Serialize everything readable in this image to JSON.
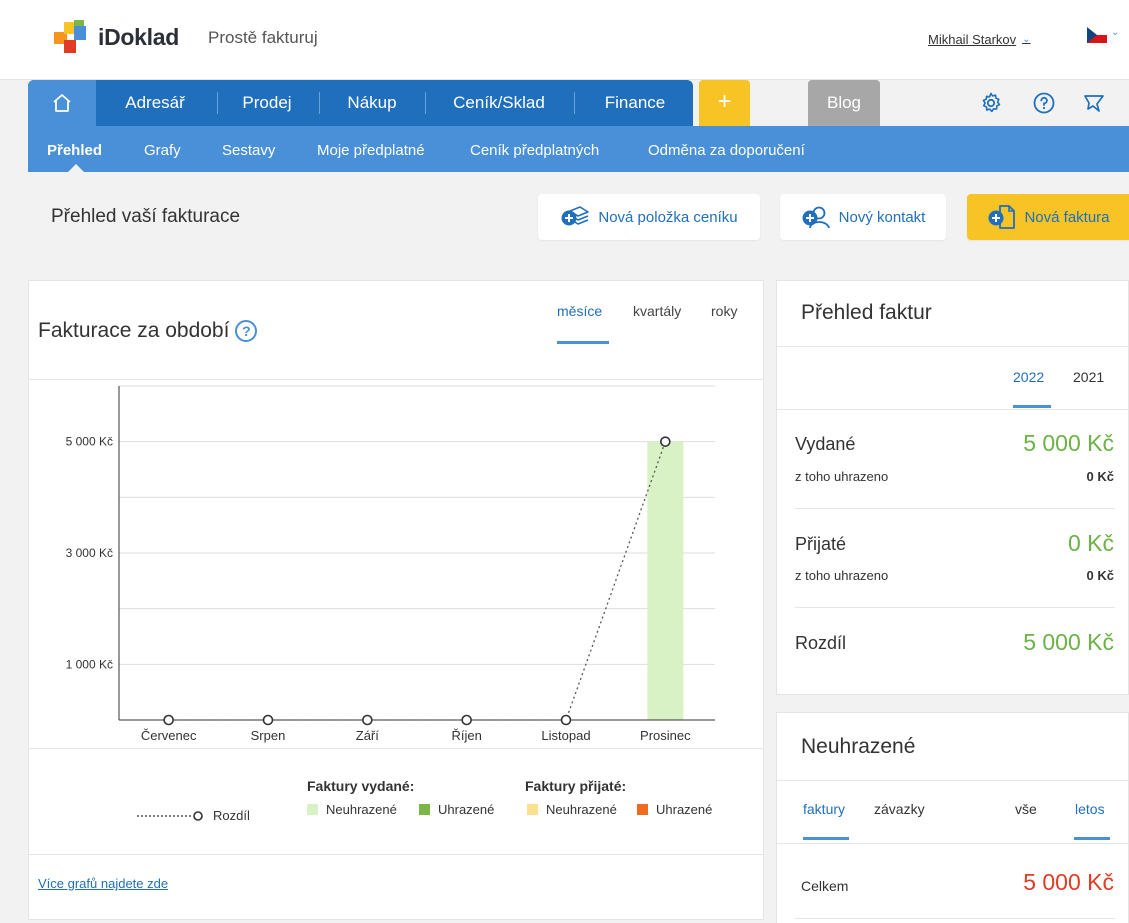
{
  "header": {
    "logo_text": "iDoklad",
    "tagline": "Prostě fakturuj",
    "user_name": "Mikhail Starkov"
  },
  "main_nav": {
    "items": [
      {
        "label": "Adresář"
      },
      {
        "label": "Prodej"
      },
      {
        "label": "Nákup"
      },
      {
        "label": "Ceník/Sklad"
      },
      {
        "label": "Finance"
      }
    ],
    "plus_label": "+",
    "blog_label": "Blog"
  },
  "sub_nav": {
    "items": [
      {
        "label": "Přehled",
        "active": true
      },
      {
        "label": "Grafy"
      },
      {
        "label": "Sestavy"
      },
      {
        "label": "Moje předplatné"
      },
      {
        "label": "Ceník předplatných"
      },
      {
        "label": "Odměna za doporučení"
      }
    ]
  },
  "page": {
    "title": "Přehled vaší fakturace",
    "buttons": {
      "new_item": "Nová položka ceníku",
      "new_contact": "Nový kontakt",
      "new_invoice": "Nová faktura"
    }
  },
  "chart_card": {
    "title": "Fakturace za období",
    "period_tabs": [
      "měsíce",
      "kvartály",
      "roky"
    ],
    "legend": {
      "difference": "Rozdíl",
      "issued_head": "Faktury vydané:",
      "received_head": "Faktury přijaté:",
      "unpaid": "Neuhrazené",
      "paid": "Uhrazené"
    },
    "more_link": "Více grafů najdete zde"
  },
  "chart_data": {
    "type": "bar",
    "categories": [
      "Červenec",
      "Srpen",
      "Září",
      "Říjen",
      "Listopad",
      "Prosinec"
    ],
    "y_tick_labels": [
      "5 000 Kč",
      "3 000 Kč",
      "1 000 Kč"
    ],
    "y_ticks": [
      5000,
      3000,
      1000
    ],
    "ylim": [
      0,
      6000
    ],
    "series": [
      {
        "name": "Neuhrazené",
        "group": "Faktury vydané:",
        "values": [
          0,
          0,
          0,
          0,
          0,
          5000
        ],
        "color": "#d8f2c6"
      },
      {
        "name": "Uhrazené",
        "group": "Faktury vydané:",
        "values": [
          0,
          0,
          0,
          0,
          0,
          0
        ],
        "color": "#7ab648"
      },
      {
        "name": "Neuhrazené",
        "group": "Faktury přijaté:",
        "values": [
          0,
          0,
          0,
          0,
          0,
          0
        ],
        "color": "#fbe08e"
      },
      {
        "name": "Uhrazené",
        "group": "Faktury přijaté:",
        "values": [
          0,
          0,
          0,
          0,
          0,
          0
        ],
        "color": "#ee6b1f"
      },
      {
        "name": "Rozdíl",
        "type": "line",
        "values": [
          0,
          0,
          0,
          0,
          0,
          5000
        ],
        "color": "#555555"
      }
    ],
    "grid": true
  },
  "summary": {
    "title": "Přehled faktur",
    "years": [
      "2022",
      "2021"
    ],
    "issued_label": "Vydané",
    "issued_value": "5 000 Kč",
    "issued_paid_label": "z toho uhrazeno",
    "issued_paid_value": "0 Kč",
    "received_label": "Přijaté",
    "received_value": "0 Kč",
    "received_paid_label": "z toho uhrazeno",
    "received_paid_value": "0 Kč",
    "difference_label": "Rozdíl",
    "difference_value": "5 000 Kč"
  },
  "unpaid": {
    "title": "Neuhrazené",
    "tabs": [
      "faktury",
      "závazky"
    ],
    "filters": [
      "vše",
      "letos"
    ],
    "total_label": "Celkem",
    "total_value": "5 000 Kč"
  },
  "colors": {
    "primary": "#1f6fbd",
    "secondary": "#4a90d9",
    "accent": "#f7c325",
    "positive": "#6ab344",
    "negative": "#e23b23"
  }
}
